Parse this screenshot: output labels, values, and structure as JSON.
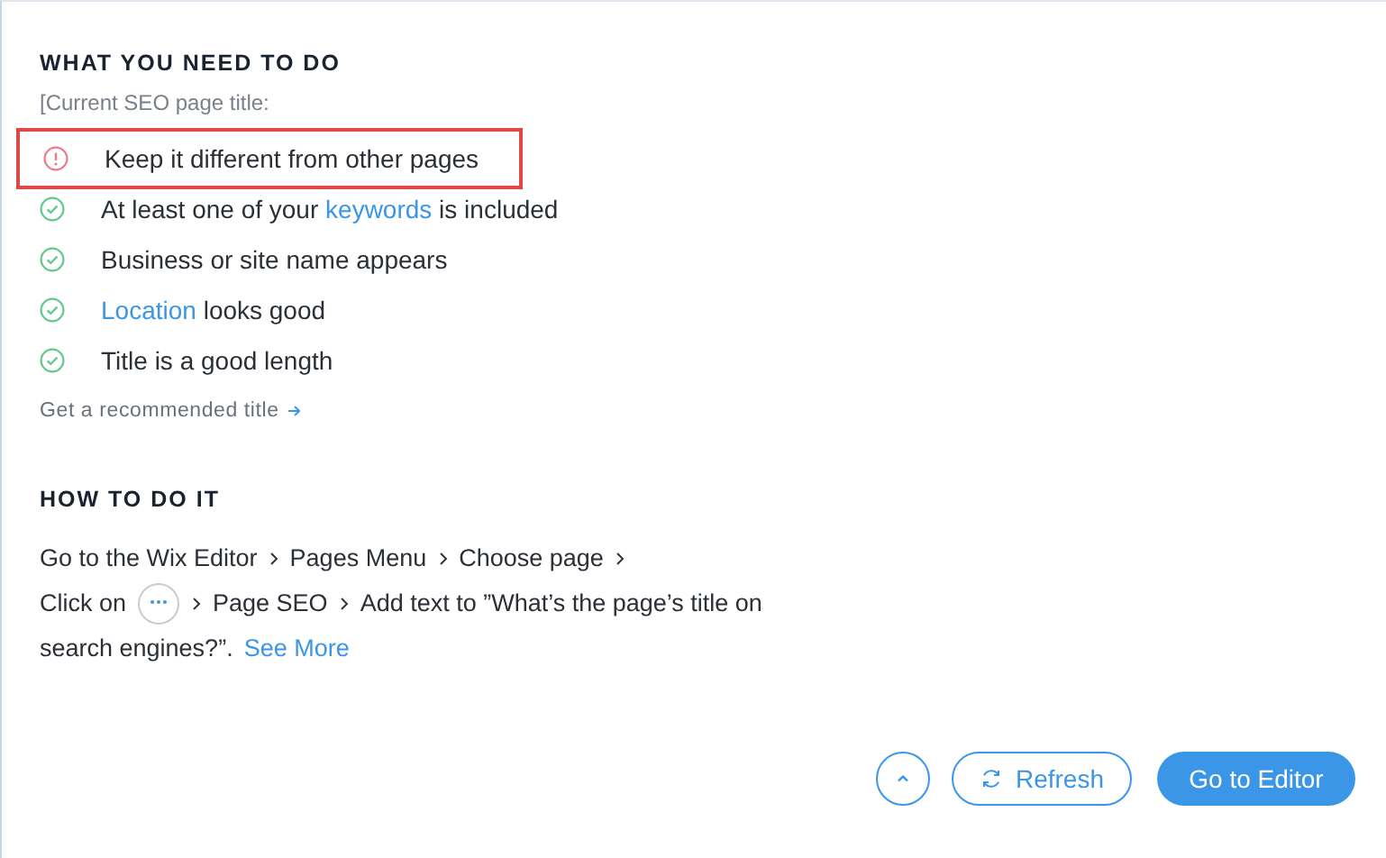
{
  "what_section": {
    "heading": "WHAT YOU NEED TO DO",
    "subtitle": "[Current SEO page title:",
    "checks": [
      {
        "kind": "warning",
        "highlighted": true,
        "parts": [
          {
            "text": "Keep it different from other pages",
            "link": false
          }
        ]
      },
      {
        "kind": "ok",
        "highlighted": false,
        "parts": [
          {
            "text": "At least one of your ",
            "link": false
          },
          {
            "text": "keywords",
            "link": true
          },
          {
            "text": " is included",
            "link": false
          }
        ]
      },
      {
        "kind": "ok",
        "highlighted": false,
        "parts": [
          {
            "text": "Business or site name appears",
            "link": false
          }
        ]
      },
      {
        "kind": "ok",
        "highlighted": false,
        "parts": [
          {
            "text": "Location",
            "link": true
          },
          {
            "text": " looks good",
            "link": false
          }
        ]
      },
      {
        "kind": "ok",
        "highlighted": false,
        "parts": [
          {
            "text": "Title is a good length",
            "link": false
          }
        ]
      }
    ],
    "recommend_link": "Get a recommended title"
  },
  "how_section": {
    "heading": "HOW TO DO IT",
    "lines": [
      [
        {
          "kind": "text",
          "text": "Go to the Wix Editor"
        },
        {
          "kind": "sep"
        },
        {
          "kind": "text",
          "text": "Pages Menu"
        },
        {
          "kind": "sep"
        },
        {
          "kind": "text",
          "text": "Choose page"
        },
        {
          "kind": "sep"
        }
      ],
      [
        {
          "kind": "text",
          "text": "Click on"
        },
        {
          "kind": "dots"
        },
        {
          "kind": "sep"
        },
        {
          "kind": "text",
          "text": "Page SEO"
        },
        {
          "kind": "sep"
        },
        {
          "kind": "text",
          "text": "Add text to ”What’s the page’s title on"
        }
      ],
      [
        {
          "kind": "text",
          "text": "search engines?”."
        },
        {
          "kind": "link",
          "text": "See More"
        }
      ]
    ]
  },
  "footer": {
    "refresh_label": "Refresh",
    "editor_label": "Go to Editor"
  }
}
